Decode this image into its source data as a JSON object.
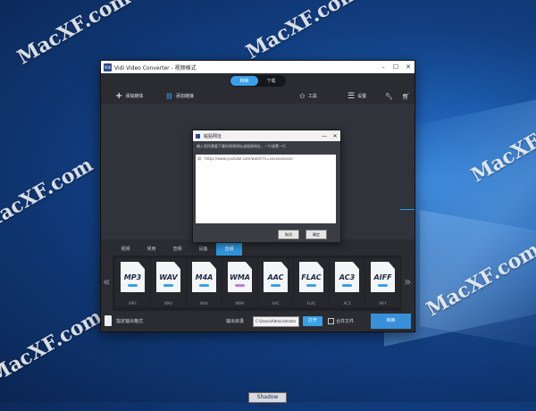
{
  "watermark": "MacXF.com",
  "window": {
    "title": "Vidi Video Converter - 视频格式",
    "logo": "Vidi",
    "controls": [
      "–",
      "☐",
      "✕"
    ]
  },
  "modes": [
    "转换",
    "下载"
  ],
  "toolbar": {
    "add_media": "添加媒体",
    "add_link": "添加链接",
    "tools": "工具",
    "settings": "设置"
  },
  "dialog": {
    "title": "粘贴网址",
    "hint": "输入您所需要下载的视频网址或链接地址，一行放置一行",
    "text": "如：https://www.youtube.com/watch?v=xxxxxxxxxxx",
    "cancel": "取消",
    "ok": "确定",
    "controls": [
      "—",
      "✕"
    ]
  },
  "format_tabs": [
    "视频",
    "常用",
    "音频",
    "设备",
    "音频"
  ],
  "format_tabs_active": 4,
  "formats": [
    {
      "label": "MP3",
      "sub": "MP3",
      "color": "#3aa0e8"
    },
    {
      "label": "WAV",
      "sub": "WAV",
      "color": "#3aa0e8"
    },
    {
      "label": "M4A",
      "sub": "M4A",
      "color": "#3aa0e8"
    },
    {
      "label": "WMA",
      "sub": "WMA",
      "color": "#b77fe0"
    },
    {
      "label": "AAC",
      "sub": "AAC",
      "color": "#3aa0e8"
    },
    {
      "label": "FLAC",
      "sub": "FLAC",
      "color": "#3aa0e8"
    },
    {
      "label": "AC3",
      "sub": "AC3",
      "color": "#3aa0e8"
    },
    {
      "label": "AIFF",
      "sub": "AIFF",
      "color": "#3aa0e8"
    }
  ],
  "bottom": {
    "output_format_label": "指定输出格式",
    "output_path_label": "输出目录",
    "output_path": "C:\\Users\\Administrator",
    "open_btn": "打开",
    "merge_label": "合并文件",
    "convert_btn": "转换"
  },
  "shadow_mode": "Shadow Mode",
  "arrows": {
    "left": "«",
    "right": "»"
  }
}
